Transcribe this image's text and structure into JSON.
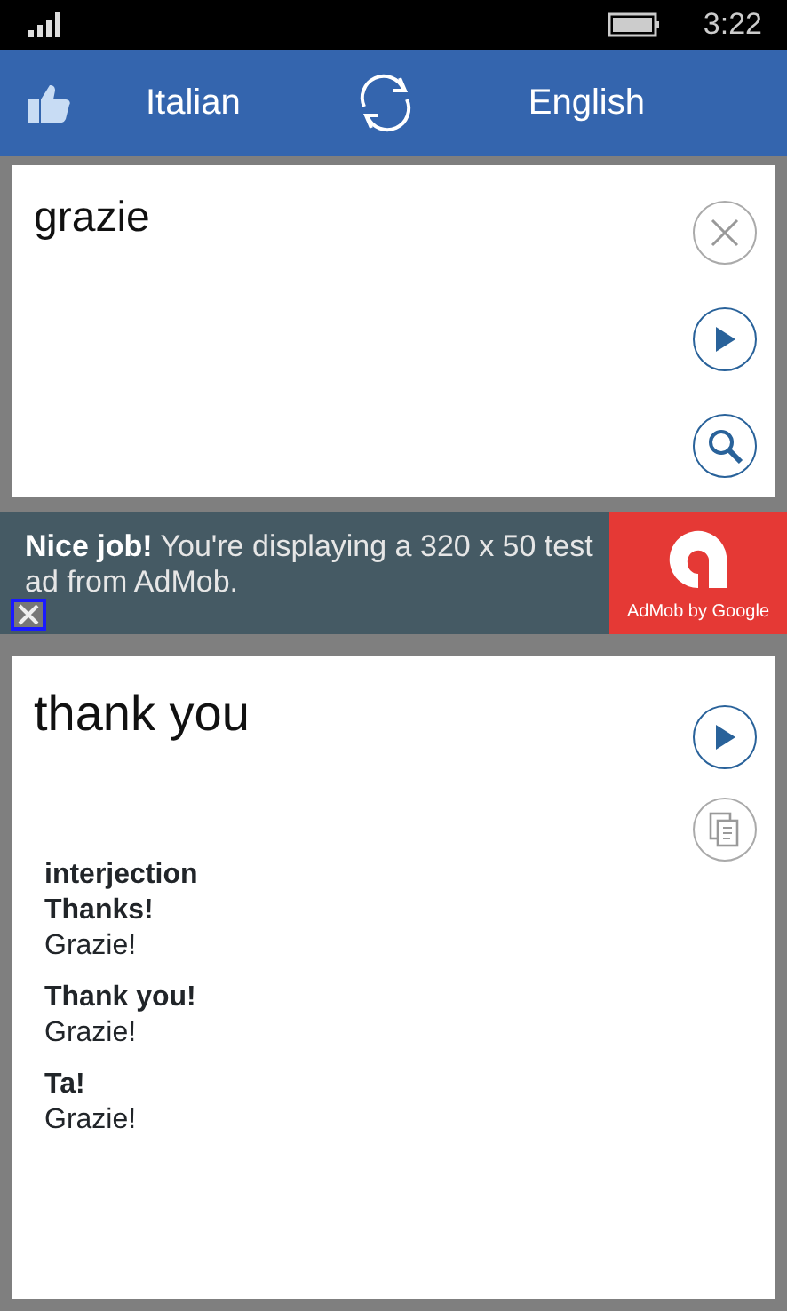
{
  "status_bar": {
    "time": "3:22"
  },
  "header": {
    "source_language": "Italian",
    "target_language": "English"
  },
  "input": {
    "value": "grazie",
    "buttons": [
      {
        "kind": "clear"
      },
      {
        "kind": "play"
      },
      {
        "kind": "search"
      }
    ]
  },
  "ad": {
    "headline": "Nice job!",
    "text": "You're displaying a 320 x 50 test ad from AdMob.",
    "brand": "AdMob by Google"
  },
  "output": {
    "translation": "thank you",
    "buttons": [
      {
        "kind": "play"
      },
      {
        "kind": "copy"
      }
    ],
    "part_of_speech": "interjection",
    "entries": [
      {
        "term": "Thanks!",
        "translation": "Grazie!"
      },
      {
        "term": "Thank you!",
        "translation": "Grazie!"
      },
      {
        "term": "Ta!",
        "translation": "Grazie!"
      }
    ]
  }
}
